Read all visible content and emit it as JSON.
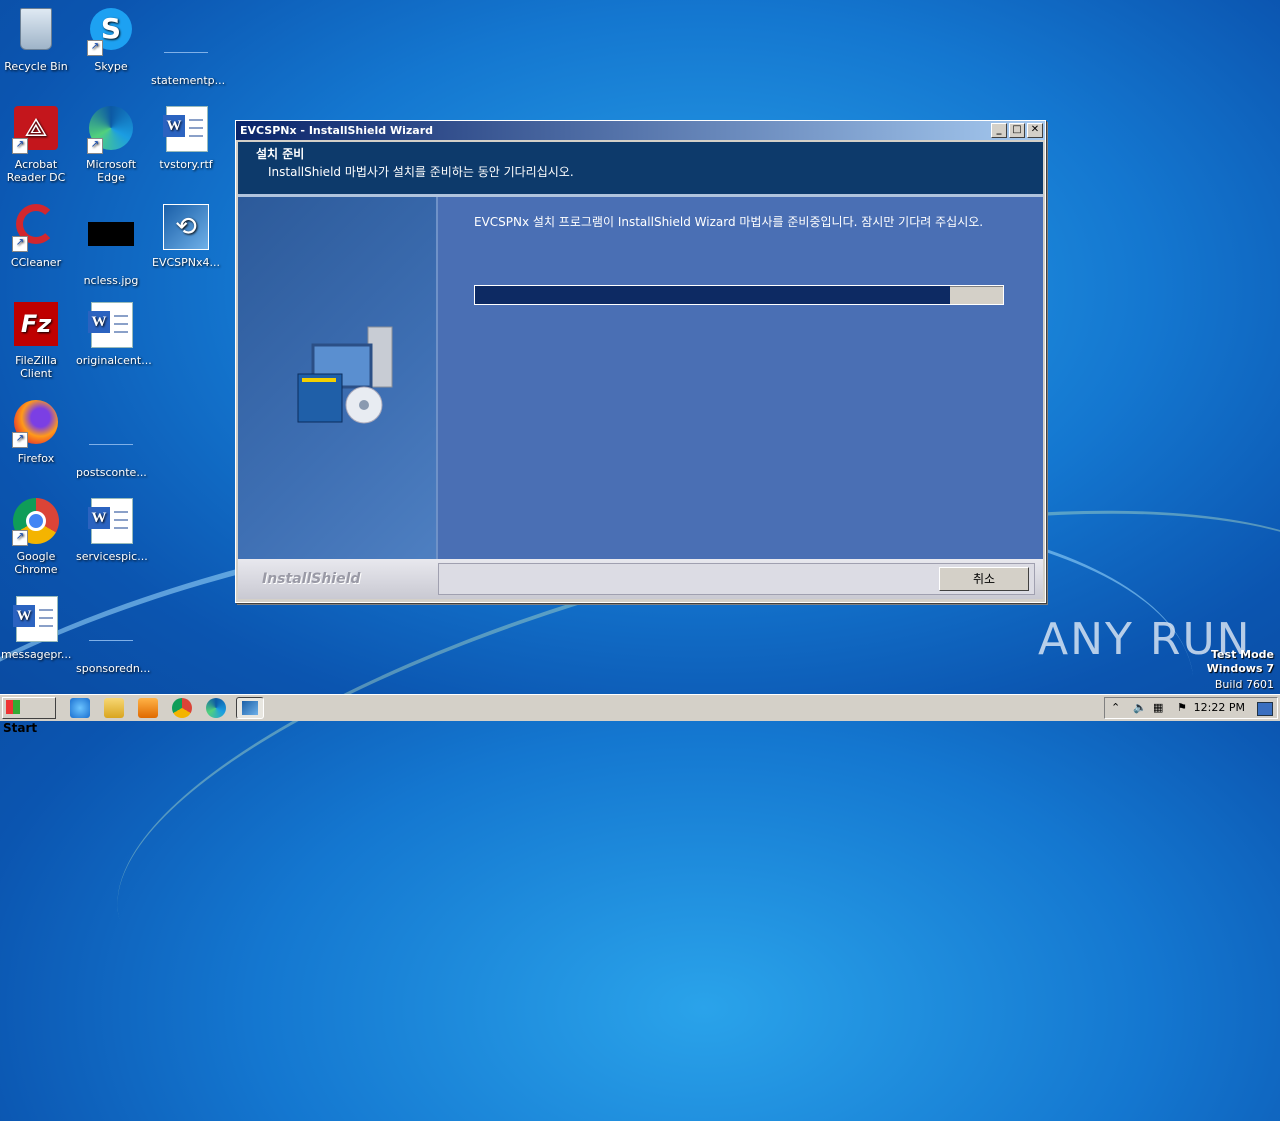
{
  "desktop": {
    "icons": [
      {
        "label": "Recycle Bin",
        "icon": "recycle-bin-icon"
      },
      {
        "label": "Skype",
        "icon": "skype-icon"
      },
      {
        "label": "statementp...",
        "icon": "blank-file-icon"
      },
      {
        "label": "Acrobat Reader DC",
        "icon": "acrobat-icon"
      },
      {
        "label": "Microsoft Edge",
        "icon": "edge-icon"
      },
      {
        "label": "tvstory.rtf",
        "icon": "word-doc-icon"
      },
      {
        "label": "CCleaner",
        "icon": "ccleaner-icon"
      },
      {
        "label": "ncless.jpg",
        "icon": "image-file-icon"
      },
      {
        "label": "EVCSPNx4...",
        "icon": "installer-icon"
      },
      {
        "label": "FileZilla Client",
        "icon": "filezilla-icon"
      },
      {
        "label": "originalcent...",
        "icon": "word-doc-icon"
      },
      {
        "label": "Firefox",
        "icon": "firefox-icon"
      },
      {
        "label": "postsconte...",
        "icon": "blank-file-icon"
      },
      {
        "label": "Google Chrome",
        "icon": "chrome-icon"
      },
      {
        "label": "servicespic...",
        "icon": "word-doc-icon"
      },
      {
        "label": "messagepr...",
        "icon": "word-doc-icon"
      },
      {
        "label": "sponsoredn...",
        "icon": "blank-file-icon"
      }
    ]
  },
  "wizard": {
    "title": "EVCSPNx - InstallShield Wizard",
    "header_title": "설치 준비",
    "header_subtitle": "InstallShield 마법사가 설치를 준비하는 동안 기다리십시오.",
    "message": "EVCSPNx 설치 프로그램이 InstallShield Wizard 마법사를 준비중입니다. 잠시만 기다려 주십시오.",
    "progress_fraction": 0.9,
    "brand": "InstallShield",
    "cancel_label": "취소",
    "title_buttons": {
      "minimize": "_",
      "maximize": "□",
      "close": "✕"
    }
  },
  "taskbar": {
    "start_label": "Start",
    "clock": "12:22 PM",
    "pinned": [
      "ie-icon",
      "explorer-icon",
      "media-player-icon",
      "chrome-icon",
      "edge-icon",
      "installer-icon"
    ]
  },
  "watermark": {
    "line1": "Test Mode",
    "line2": "Windows 7",
    "line3": "Build 7601",
    "anyrun": "ANY RUN"
  },
  "colors": {
    "header_bg": "#0d3a6b",
    "pane_bg": "#4a6fb4",
    "progress_fill": "#0d2a63"
  }
}
